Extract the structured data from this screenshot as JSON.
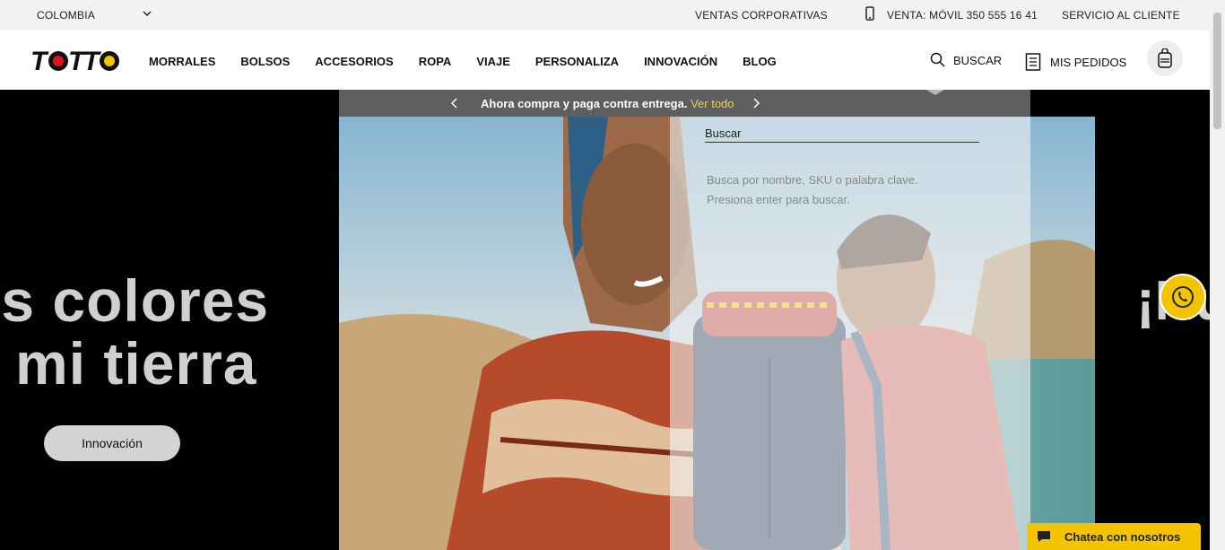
{
  "topbar": {
    "country": "COLOMBIA",
    "corporate": "VENTAS CORPORATIVAS",
    "phone": "VENTA: MÓVIL 350 555 16 41",
    "service": "SERVICIO AL CLIENTE"
  },
  "header": {
    "logo_text": "TOTTO",
    "nav": [
      "MORRALES",
      "BOLSOS",
      "ACCESORIOS",
      "ROPA",
      "VIAJE",
      "PERSONALIZA",
      "INNOVACIÓN",
      "BLOG"
    ],
    "search_label": "BUSCAR",
    "orders_label": "MIS PEDIDOS"
  },
  "promo": {
    "message": "Ahora compra y paga contra entrega.",
    "link": "Ver todo"
  },
  "search": {
    "placeholder": "Buscar",
    "hint_line1": "Busca por nombre, SKU o palabra clave.",
    "hint_line2": "Presiona enter para buscar."
  },
  "hero": {
    "title": "os colores\ne mi tierra",
    "button": "Innovación",
    "next_title_fragment": "¡Nu"
  },
  "chat": {
    "label": "Chatea con nosotros"
  },
  "colors": {
    "accent": "#f5c400",
    "promo_link": "#f1d04a"
  }
}
